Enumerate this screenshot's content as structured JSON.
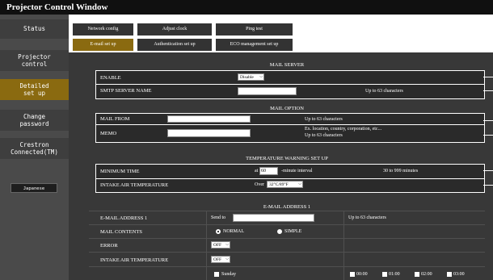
{
  "window_title": "Projector Control Window",
  "sidebar": {
    "items": [
      {
        "label": "Status"
      },
      {
        "label_line1": "Projector",
        "label_line2": "control"
      },
      {
        "label_line1": "Detailed",
        "label_line2": "set up"
      },
      {
        "label_line1": "Change",
        "label_line2": "password"
      },
      {
        "label_line1": "Crestron",
        "label_line2": "Connected(TM)"
      }
    ],
    "language": "Japanese"
  },
  "tabs": {
    "row1": [
      "Network config",
      "Adjust clock",
      "Ping test"
    ],
    "row2": [
      "E-mail set up",
      "Authentication set up",
      "ECO management set up"
    ]
  },
  "mail_server": {
    "title": "MAIL SERVER",
    "enable_label": "ENABLE",
    "enable_value": "Disable",
    "smtp_label": "SMTP SERVER NAME",
    "smtp_value": "",
    "smtp_note": "Up to 63 characters"
  },
  "mail_option": {
    "title": "MAIL OPTION",
    "from_label": "MAIL FROM",
    "from_value": "",
    "from_note": "Up to 63 characters",
    "memo_label": "MEMO",
    "memo_value": "",
    "memo_note_line1": "Ex. location, country, corporation, etc...",
    "memo_note_line2": "Up to 63 characters"
  },
  "temp_warning": {
    "title": "TEMPERATURE WARNING SET UP",
    "min_time_label": "MINIMUM TIME",
    "min_time_prefix": "at",
    "min_time_value": "60",
    "min_time_suffix": "-minute interval",
    "min_time_note": "30 to 999 minutes",
    "intake_label": "INTAKE AIR TEMPERATURE",
    "intake_value": "Over",
    "intake_select": "32°C/89°F"
  },
  "email_address1": {
    "title": "E-MAIL ADDRESS 1",
    "addr_label": "E-MAIL ADDRESS 1",
    "addr_prefix": "Send to",
    "addr_value": "",
    "addr_note": "Up to 63 characters",
    "contents_label": "MAIL CONTENTS",
    "contents_normal": "NORMAL",
    "contents_simple": "SIMPLE",
    "error_label": "ERROR",
    "error_value": "OFF",
    "intake_label": "INTAKE AIR TEMPERATURE",
    "intake_value": "OFF",
    "day_label": "Sunday",
    "times": [
      "00:00",
      "01:00",
      "02:00",
      "03:00"
    ]
  }
}
